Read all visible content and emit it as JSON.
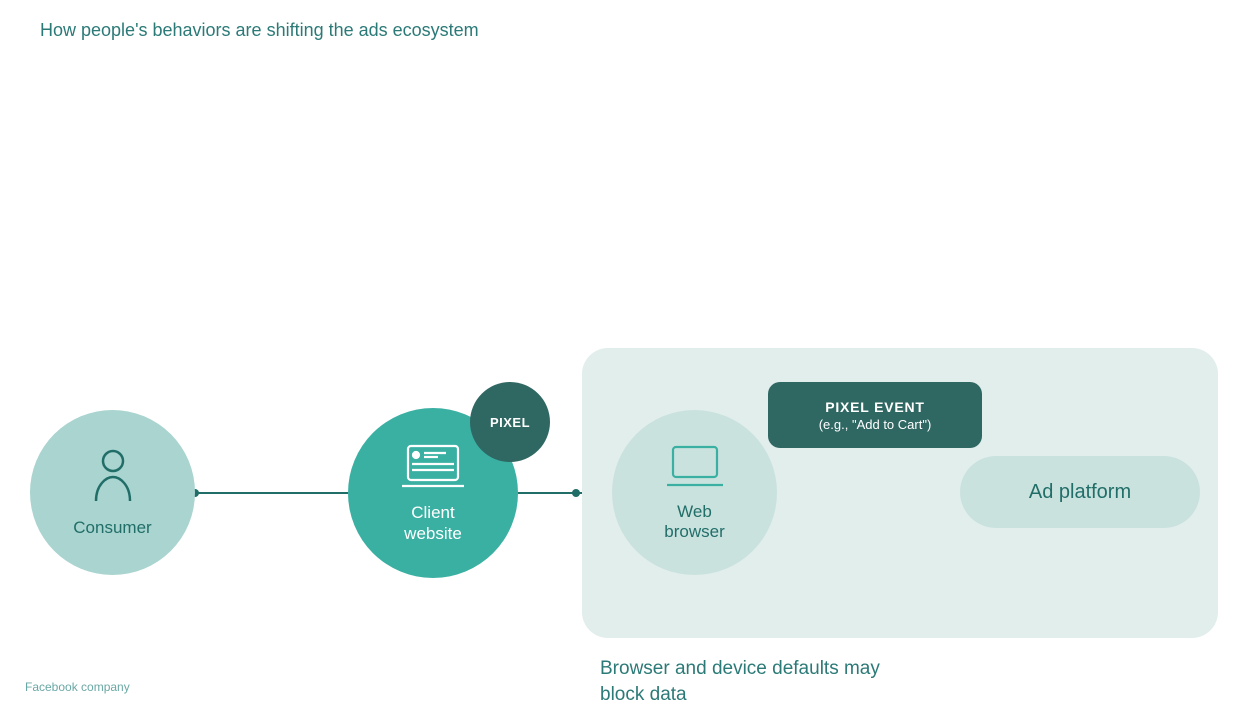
{
  "title": "How people's behaviors are shifting the ads ecosystem",
  "footer": "Facebook company",
  "nodes": {
    "consumer": {
      "label": "Consumer"
    },
    "client": {
      "label": "Client\nwebsite"
    },
    "pixel_badge": "PIXEL",
    "browser": {
      "label": "Web\nbrowser"
    },
    "event": {
      "title": "PIXEL EVENT",
      "sub": "(e.g., \"Add to Cart\")"
    },
    "ad_platform": {
      "label": "Ad platform"
    }
  },
  "block_note": "Browser and device defaults may block data",
  "colors": {
    "teal_dark": "#2f6763",
    "teal_medium": "#3ab0a3",
    "teal_light": "#a9d4cf",
    "teal_pale": "#cae2de",
    "teal_bg": "#e1eeec",
    "text": "#216e69"
  }
}
